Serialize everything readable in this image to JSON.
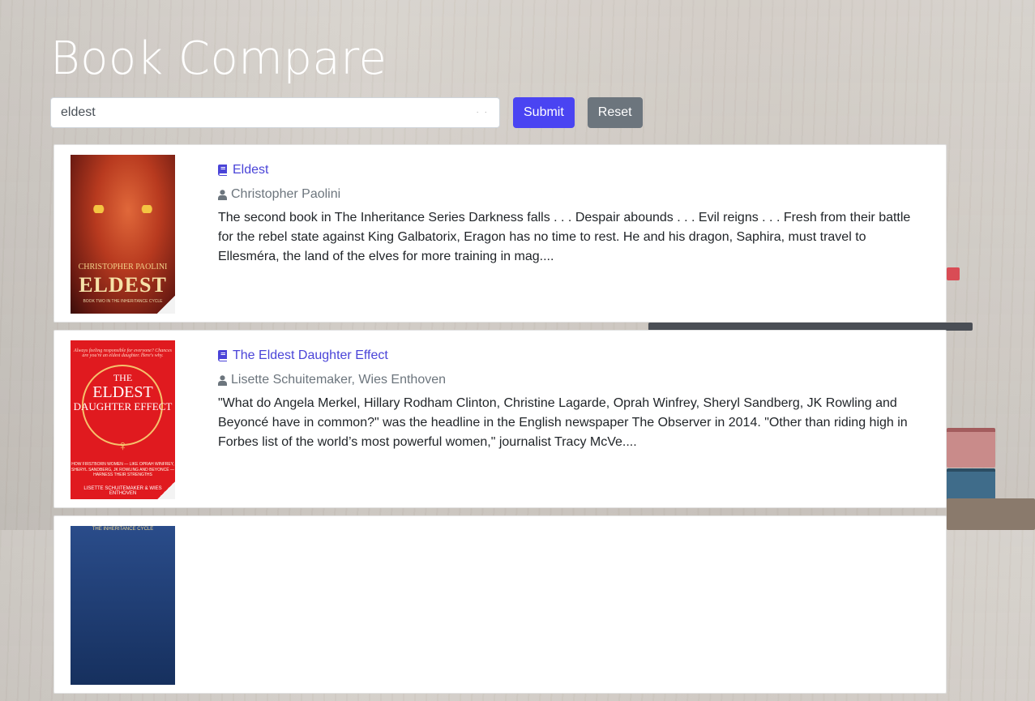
{
  "header": {
    "title": "Book Compare"
  },
  "search": {
    "value": "eldest",
    "submit_label": "Submit",
    "reset_label": "Reset"
  },
  "icons": {
    "title_icon": "book-icon",
    "author_icon": "user-icon"
  },
  "colors": {
    "link": "#4a44d8",
    "submit": "#4a44f2",
    "reset": "#6c757d"
  },
  "results": [
    {
      "title": "Eldest",
      "author": "Christopher Paolini",
      "description": "The second book in The Inheritance Series Darkness falls . . . Despair abounds . . . Evil reigns . . . Fresh from their battle for the rebel state against King Galbatorix, Eragon has no time to rest. He and his dragon, Saphira, must travel to Ellesméra, the land of the elves for more training in mag....",
      "cover": {
        "author_text": "CHRISTOPHER PAOLINI",
        "title_text": "ELDEST",
        "subtitle_text": "BOOK TWO IN THE INHERITANCE CYCLE"
      }
    },
    {
      "title": "The Eldest Daughter Effect",
      "author": "Lisette Schuitemaker, Wies Enthoven",
      "description": "\"What do Angela Merkel, Hillary Rodham Clinton, Christine Lagarde, Oprah Winfrey, Sheryl Sandberg, JK Rowling and Beyoncé have in common?\" was the headline in the English newspaper The Observer in 2014. \"Other than riding high in Forbes list of the world’s most powerful women,\" journalist Tracy McVe....",
      "cover": {
        "tagline": "Always feeling responsible for everyone? Chances are you're an eldest daughter. Here's why.",
        "title_a": "THE",
        "title_b": "ELDEST",
        "title_c": "DAUGHTER EFFECT",
        "blurb": "HOW FIRSTBORN WOMEN — LIKE OPRAH WINFREY, SHERYL SANDBERG, JK ROWLING AND BEYONCÉ — HARNESS THEIR STRENGTHS",
        "author_text": "LISETTE SCHUITEMAKER & WIES ENTHOVEN"
      }
    },
    {
      "cover": {
        "author_text": "THE INHERITANCE CYCLE"
      }
    }
  ]
}
